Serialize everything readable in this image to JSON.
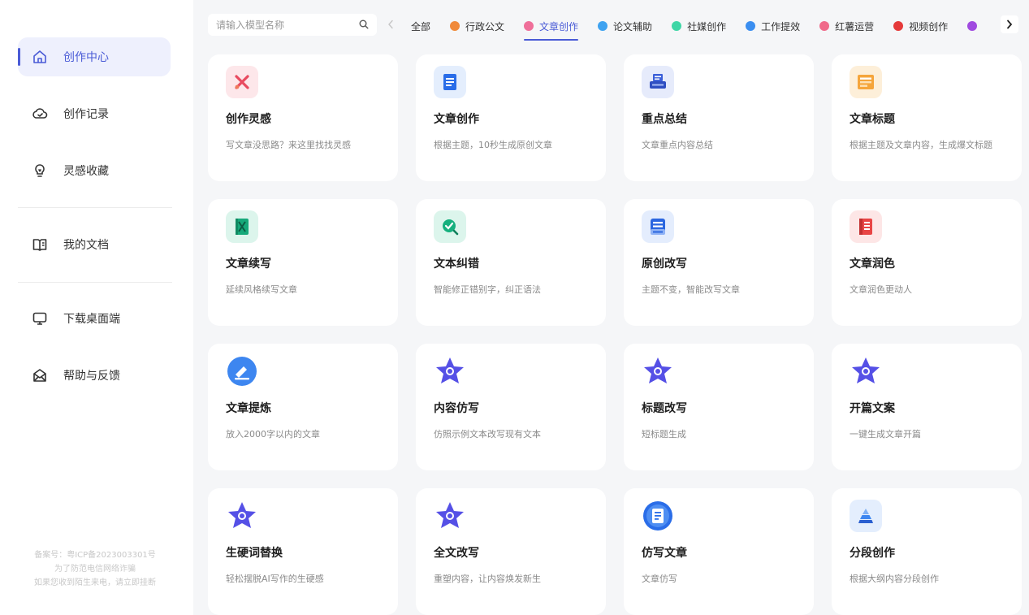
{
  "sidebar": {
    "items": [
      {
        "label": "创作中心",
        "icon": "home-icon"
      },
      {
        "label": "创作记录",
        "icon": "cloud-history-icon"
      },
      {
        "label": "灵感收藏",
        "icon": "lightbulb-icon"
      },
      {
        "label": "我的文档",
        "icon": "book-icon"
      },
      {
        "label": "下载桌面端",
        "icon": "monitor-icon"
      },
      {
        "label": "帮助与反馈",
        "icon": "mail-icon"
      }
    ],
    "footer": [
      "备案号：粤ICP备2023003301号",
      "为了防范电信网络诈骗",
      "如果您收到陌生来电，请立即挂断"
    ]
  },
  "search": {
    "placeholder": "请输入模型名称"
  },
  "tabs": [
    {
      "label": "全部",
      "color": ""
    },
    {
      "label": "行政公文",
      "color": "#f08a3b"
    },
    {
      "label": "文章创作",
      "color": "#ef6f9a"
    },
    {
      "label": "论文辅助",
      "color": "#3ea2f0"
    },
    {
      "label": "社媒创作",
      "color": "#3fd6a6"
    },
    {
      "label": "工作提效",
      "color": "#3a8ef0"
    },
    {
      "label": "红薯运营",
      "color": "#f06a8a"
    },
    {
      "label": "视频创作",
      "color": "#e53a3a"
    },
    {
      "label": "",
      "color": "#a04ae0"
    }
  ],
  "active_tab": "文章创作",
  "accent_color": "#4a5bd6",
  "cards": [
    {
      "title": "创作灵感",
      "desc": "写文章没思路？来这里找找灵感",
      "icon": "sparkle-cross-icon",
      "bg": "#fde7ea"
    },
    {
      "title": "文章创作",
      "desc": "根据主题，10秒生成原创文章",
      "icon": "document-icon",
      "bg": "#e4eefd"
    },
    {
      "title": "重点总结",
      "desc": "文章重点内容总结",
      "icon": "printer-icon",
      "bg": "#e6ebfb"
    },
    {
      "title": "文章标题",
      "desc": "根据主题及文章内容，生成爆文标题",
      "icon": "title-sheet-icon",
      "bg": "#fdefd9"
    },
    {
      "title": "文章续写",
      "desc": "延续风格续写文章",
      "icon": "green-book-icon",
      "bg": "#dcf5ec"
    },
    {
      "title": "文本纠错",
      "desc": "智能修正错别字，纠正语法",
      "icon": "check-search-icon",
      "bg": "#dcf5ec"
    },
    {
      "title": "原创改写",
      "desc": "主题不变，智能改写文章",
      "icon": "rewrite-doc-icon",
      "bg": "#e4edfd"
    },
    {
      "title": "文章润色",
      "desc": "文章润色更动人",
      "icon": "red-book-icon",
      "bg": "#fde6e6"
    },
    {
      "title": "文章提炼",
      "desc": "放入2000字以内的文章",
      "icon": "pen-circle-icon",
      "bg": ""
    },
    {
      "title": "内容仿写",
      "desc": "仿照示例文本改写现有文本",
      "icon": "star-icon",
      "bg": ""
    },
    {
      "title": "标题改写",
      "desc": "短标题生成",
      "icon": "star-icon",
      "bg": ""
    },
    {
      "title": "开篇文案",
      "desc": "一键生成文章开篇",
      "icon": "star-icon",
      "bg": ""
    },
    {
      "title": "生硬词替换",
      "desc": "轻松摆脱AI写作的生硬感",
      "icon": "star-icon",
      "bg": ""
    },
    {
      "title": "全文改写",
      "desc": "重塑内容，让内容焕发新生",
      "icon": "star-icon",
      "bg": ""
    },
    {
      "title": "仿写文章",
      "desc": "文章仿写",
      "icon": "blue-doc-circle-icon",
      "bg": ""
    },
    {
      "title": "分段创作",
      "desc": "根据大纲内容分段创作",
      "icon": "pyramid-icon",
      "bg": "#e4eefd"
    }
  ]
}
